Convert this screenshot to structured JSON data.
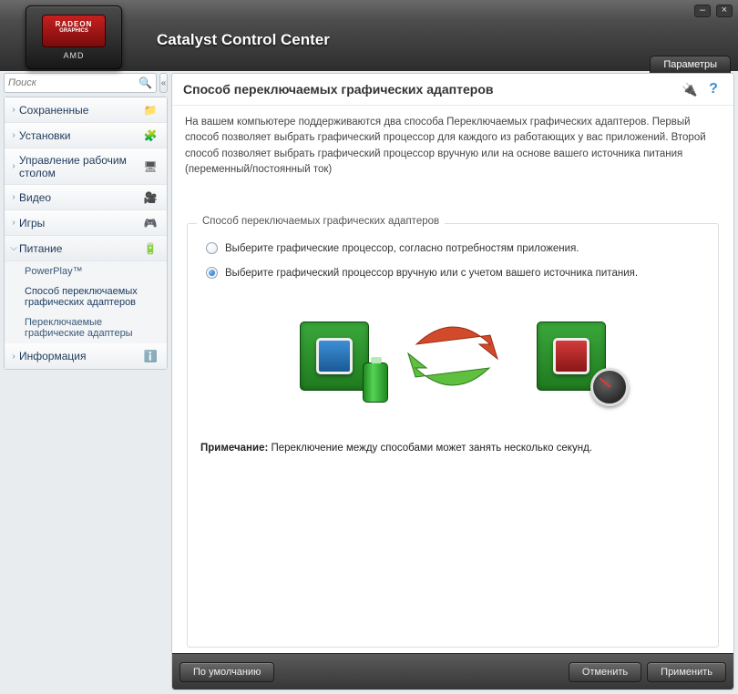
{
  "titlebar": {
    "minimize": "–",
    "close": "×"
  },
  "header": {
    "logo_top": "RADEON",
    "logo_sub": "GRAPHICS",
    "logo_brand": "AMD",
    "app_title": "Catalyst Control Center",
    "params_button": "Параметры"
  },
  "search": {
    "placeholder": "Поиск"
  },
  "sidebar": {
    "items": [
      {
        "label": "Сохраненные",
        "icon": "📁",
        "expandable": true
      },
      {
        "label": "Установки",
        "icon": "🧩",
        "expandable": true
      },
      {
        "label": "Управление рабочим столом",
        "icon": "🖥",
        "expandable": true,
        "tall": true
      },
      {
        "label": "Видео",
        "icon": "🎥",
        "expandable": true
      },
      {
        "label": "Игры",
        "icon": "🎮",
        "expandable": true
      },
      {
        "label": "Питание",
        "icon": "🔋",
        "expandable": true,
        "expanded": true,
        "children": [
          {
            "label": "PowerPlay™"
          },
          {
            "label": "Способ переключаемых графических адаптеров",
            "selected": true
          },
          {
            "label": "Переключаемые графические адаптеры"
          }
        ]
      },
      {
        "label": "Информация",
        "icon": "ℹ️",
        "expandable": true
      }
    ]
  },
  "page": {
    "title": "Способ переключаемых графических адаптеров",
    "description": "На вашем компьютере поддерживаются два способа Переключаемых графических адаптеров. Первый способ позволяет выбрать графический процессор для каждого из работающих у вас приложений. Второй способ позволяет выбрать графический процессор вручную или на основе вашего источника питания (переменный/постоянный ток)",
    "group_legend": "Способ переключаемых графических адаптеров",
    "option1": "Выберите графические процессор, согласно потребностям приложения.",
    "option2": "Выберите графический процессор вручную или с учетом вашего источника питания.",
    "note_label": "Примечание:",
    "note_text": "Переключение между способами может занять несколько секунд."
  },
  "footer": {
    "defaults": "По умолчанию",
    "cancel": "Отменить",
    "apply": "Применить"
  }
}
